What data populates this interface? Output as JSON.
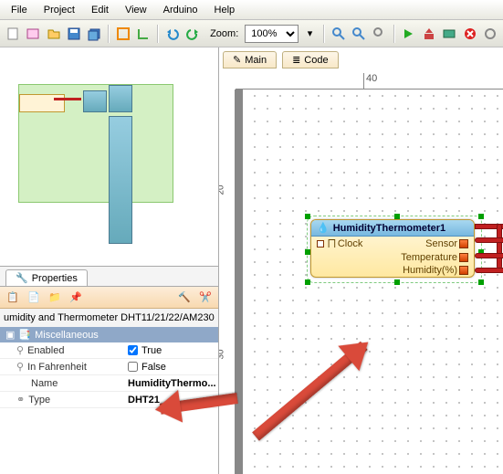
{
  "menu": {
    "file": "File",
    "project": "Project",
    "edit": "Edit",
    "view": "View",
    "arduino": "Arduino",
    "help": "Help"
  },
  "toolbar": {
    "zoom_label": "Zoom:",
    "zoom_value": "100%"
  },
  "canvas": {
    "tabs": {
      "main": "Main",
      "code": "Code"
    },
    "ruler_h": {
      "mark40": "40"
    },
    "ruler_v": {
      "mark20": "20",
      "mark30": "30"
    }
  },
  "component": {
    "title": "HumidityThermometer1",
    "pins": {
      "clock": "Clock",
      "sensor": "Sensor",
      "temperature": "Temperature",
      "humidity": "Humidity(%)"
    }
  },
  "properties": {
    "tab": "Properties",
    "title": "umidity and Thermometer DHT11/21/22/AM230",
    "group": "Miscellaneous",
    "rows": {
      "enabled_label": "Enabled",
      "enabled_value": "True",
      "fahrenheit_label": "In Fahrenheit",
      "fahrenheit_value": "False",
      "name_label": "Name",
      "name_value": "HumidityThermo...",
      "type_label": "Type",
      "type_value": "DHT21"
    }
  }
}
